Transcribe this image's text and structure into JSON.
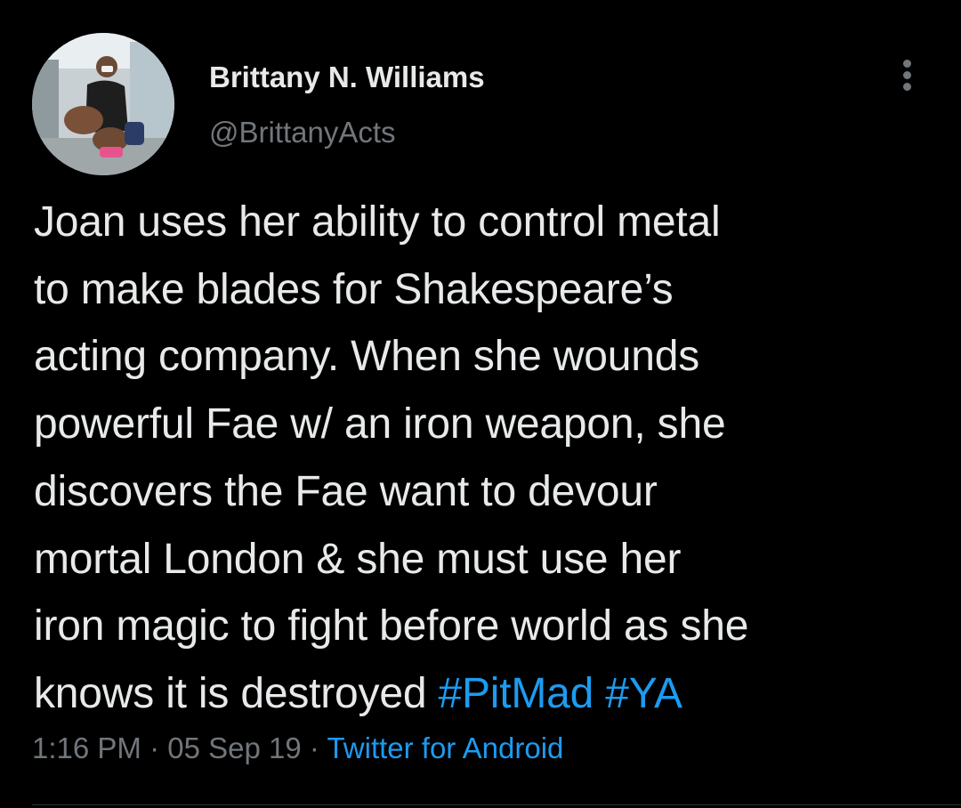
{
  "tweet": {
    "author": {
      "name": "Brittany N. Williams",
      "handle": "@BrittanyActs"
    },
    "text_lines": [
      "Joan uses her ability to control metal",
      "to make blades for Shakespeare’s",
      "acting company. When she wounds",
      "powerful Fae w/ an iron weapon, she",
      "discovers the Fae want to devour",
      "mortal London & she must use her",
      "iron magic to fight before world as she",
      "knows it is destroyed "
    ],
    "hashtags": [
      "#PitMad",
      "#YA"
    ],
    "time": "1:16 PM",
    "separator": " · ",
    "date": "05 Sep 19",
    "source": "Twitter for Android"
  },
  "icons": {
    "more": "more-vertical-icon"
  },
  "colors": {
    "background": "#000000",
    "text": "#e7e9ea",
    "secondary": "#71767b",
    "link": "#1d9bf0"
  }
}
